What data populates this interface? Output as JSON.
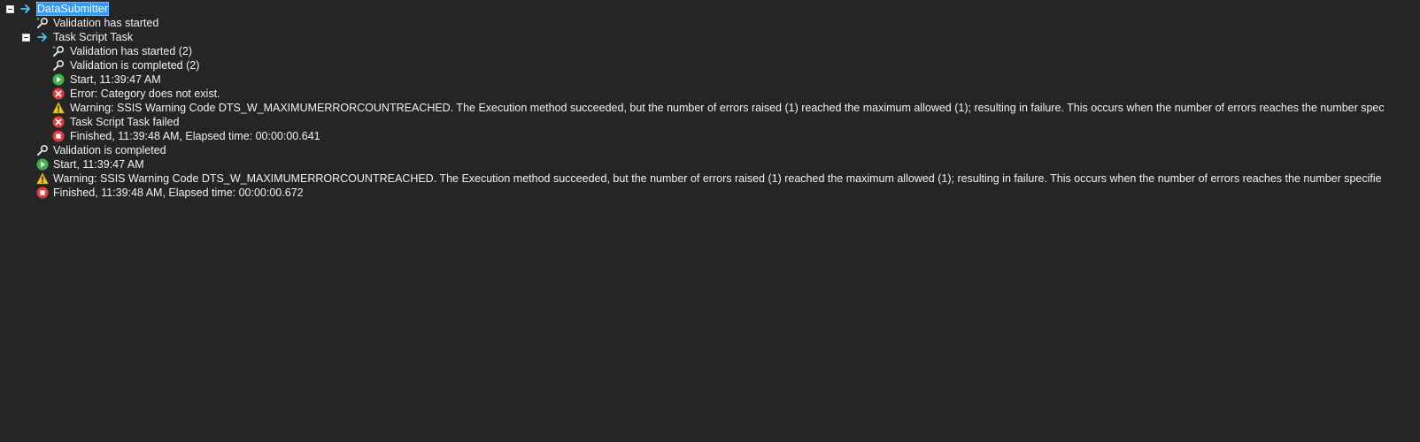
{
  "tree": {
    "root": {
      "label": "DataSubmitter",
      "icon": "arrow-right-icon",
      "expanded": true,
      "selected": true
    },
    "root_validation_started": {
      "label": "Validation has started",
      "icon": "validation-started-icon"
    },
    "task": {
      "label": "Task Script Task",
      "icon": "arrow-right-icon",
      "expanded": true
    },
    "task_children": [
      {
        "label": "Validation has started (2)",
        "icon": "validation-started-icon"
      },
      {
        "label": "Validation is completed (2)",
        "icon": "validation-completed-icon"
      },
      {
        "label": "Start, 11:39:47 AM",
        "icon": "start-icon"
      },
      {
        "label": "Error: Category does not exist.",
        "icon": "error-icon"
      },
      {
        "label": "Warning: SSIS Warning Code DTS_W_MAXIMUMERRORCOUNTREACHED.  The Execution method succeeded, but the number of errors raised (1) reached the maximum allowed (1); resulting in failure. This occurs when the number of errors reaches the number spec",
        "icon": "warning-icon"
      },
      {
        "label": "Task Script Task failed",
        "icon": "error-icon"
      },
      {
        "label": "Finished, 11:39:48 AM, Elapsed time: 00:00:00.641",
        "icon": "finished-icon"
      }
    ],
    "root_children_after": [
      {
        "label": "Validation is completed",
        "icon": "validation-completed-icon"
      },
      {
        "label": "Start, 11:39:47 AM",
        "icon": "start-icon"
      },
      {
        "label": "Warning: SSIS Warning Code DTS_W_MAXIMUMERRORCOUNTREACHED.  The Execution method succeeded, but the number of errors raised (1) reached the maximum allowed (1); resulting in failure. This occurs when the number of errors reaches the number specifie",
        "icon": "warning-icon"
      },
      {
        "label": "Finished, 11:39:48 AM, Elapsed time: 00:00:00.672",
        "icon": "finished-icon"
      }
    ]
  },
  "colors": {
    "background": "#252526",
    "text": "#f1f1f1",
    "selection": "#3399ff",
    "arrow": "#4fc3f7",
    "start": "#3cb44b",
    "error": "#e23b3b",
    "warning": "#f5c518"
  }
}
